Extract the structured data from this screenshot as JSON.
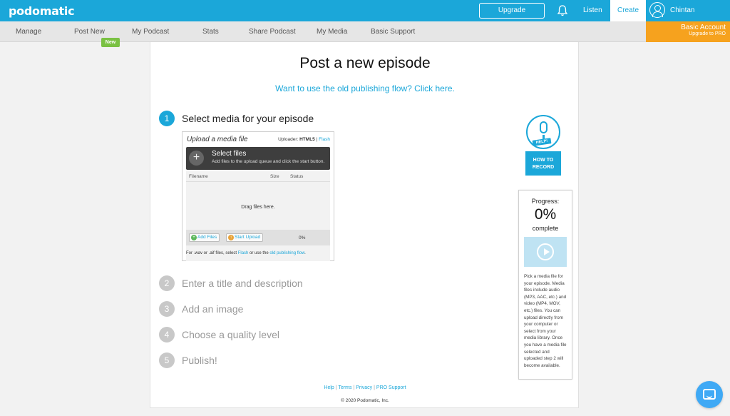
{
  "brand": {
    "logo_text": "podomatic"
  },
  "topbar": {
    "upgrade_label": "Upgrade",
    "listen_label": "Listen",
    "create_label": "Create",
    "username": "Chintan"
  },
  "subnav": {
    "items": [
      "Manage",
      "Post New",
      "My Podcast",
      "Stats",
      "Share Podcast",
      "My Media",
      "Basic Support"
    ],
    "new_badge": "New"
  },
  "account": {
    "title": "Basic Account",
    "subtitle": "Upgrade to PRO"
  },
  "main": {
    "title": "Post a new episode",
    "old_flow_link": "Want to use the old publishing flow? Click here."
  },
  "steps": [
    {
      "number": "1",
      "label": "Select media for your episode"
    },
    {
      "number": "2",
      "label": "Enter a title and description"
    },
    {
      "number": "3",
      "label": "Add an image"
    },
    {
      "number": "4",
      "label": "Choose a quality level"
    },
    {
      "number": "5",
      "label": "Publish!"
    }
  ],
  "uploader": {
    "header": "Upload a media file",
    "mode_prefix": "Uploader:",
    "mode_current": "HTML5",
    "mode_alt": "Flash",
    "select_title": "Select files",
    "select_desc": "Add files to the upload queue and click the start button.",
    "col_filename": "Filename",
    "col_size": "Size",
    "col_status": "Status",
    "drag_text": "Drag files here.",
    "add_files": "Add Files",
    "start_upload": "Start Upload",
    "percent": "0%",
    "note_prefix": "For .wav or .aif files, select",
    "note_flash": "Flash",
    "note_middle": "or use the",
    "note_link": "old publishing flow",
    "note_end": "."
  },
  "howto": {
    "help_tag": "HELP!",
    "button_line1": "HOW TO",
    "button_line2": "RECORD"
  },
  "progress": {
    "label": "Progress:",
    "percent": "0%",
    "complete": "complete",
    "description": "Pick a media file for your episode. Media files include audio (MP3, AAC, etc.) and video (MP4, MOV, etc.) files. You can upload directly from your computer or select from your media library. Once you have a media file selected and uploaded step 2 will become available."
  },
  "footer": {
    "links": [
      "Help",
      "Terms",
      "Privacy",
      "PRO Support"
    ],
    "copyright": "© 2020 Podomatic, Inc."
  },
  "colors": {
    "accent": "#1ba7d9",
    "pro_orange": "#f6a21e",
    "badge_green": "#7ac143"
  }
}
